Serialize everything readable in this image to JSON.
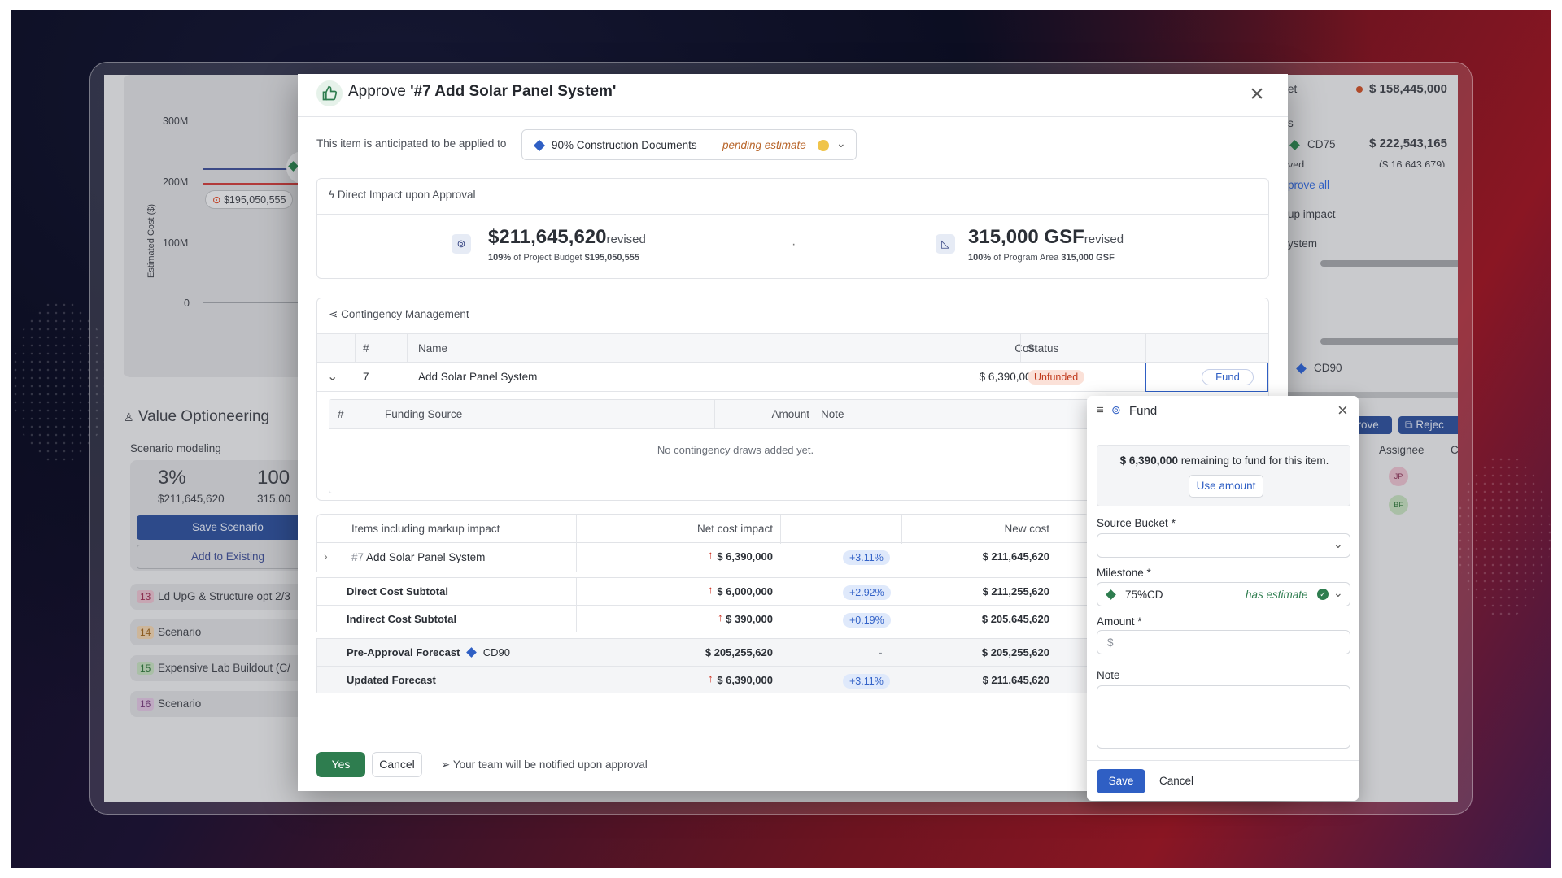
{
  "background_app": {
    "chart": {
      "ylabel": "Estimated Cost ($)",
      "yticks": [
        "300M",
        "200M",
        "100M",
        "0"
      ],
      "budget_marker": "$195,050,555"
    },
    "value_optioneering": {
      "title": "Value Optioneering",
      "subtitle": "Scenario modeling",
      "pct": "3%",
      "amount": "$211,645,620",
      "pct2": "100",
      "area2": "315,00",
      "save_label": "Save Scenario",
      "add_label": "Add to Existing",
      "scenarios": [
        {
          "num": "13",
          "name": "Ld UpG & Structure opt 2/3"
        },
        {
          "num": "14",
          "name": "Scenario"
        },
        {
          "num": "15",
          "name": "Expensive Lab Buildout (C/"
        },
        {
          "num": "16",
          "name": "Scenario"
        }
      ]
    },
    "right_panel": {
      "budget_label": "et",
      "budget_value": "$ 158,445,000",
      "s_label": "s",
      "cd75_label": "CD75",
      "cd75_value": "$ 222,543,165",
      "ved_label": "ved",
      "ved_value": "($ 16,643,679)",
      "approve_all": "prove all",
      "up_impact": "up impact",
      "system": "ystem",
      "cd90": "CD90",
      "approve_btn": "prove",
      "reject_btn": "Rejec",
      "assignee": "Assignee",
      "c_col": "C",
      "avatars": [
        "JP",
        "BF"
      ]
    }
  },
  "modal": {
    "title_prefix": "Approve",
    "title_item": "'#7 Add Solar Panel System'",
    "applied_text": "This item is anticipated to be applied to",
    "milestone": "90% Construction Documents",
    "milestone_status": "pending estimate",
    "direct_impact": {
      "heading": "Direct Impact upon Approval",
      "cost_value": "$211,645,620",
      "cost_suffix": "revised",
      "cost_pct": "109%",
      "cost_of": "of Project Budget",
      "cost_budget": "$195,050,555",
      "dot": "·",
      "area_value": "315,000 GSF",
      "area_suffix": "revised",
      "area_pct": "100%",
      "area_of": "of Program Area",
      "area_total": "315,000 GSF"
    },
    "contingency": {
      "heading": "Contingency Management",
      "columns": [
        "#",
        "Name",
        "Cost",
        "Status"
      ],
      "row": {
        "num": "7",
        "name": "Add Solar Panel System",
        "cost": "$ 6,390,000",
        "status": "Unfunded",
        "action": "Fund"
      },
      "sub_columns": [
        "#",
        "Funding Source",
        "Amount",
        "Note"
      ],
      "empty": "No contingency draws added yet."
    },
    "impact_table": {
      "columns": [
        "Items including markup impact",
        "Net cost impact",
        "New cost"
      ],
      "rows": [
        {
          "prefix": "#7",
          "name": "Add Solar Panel System",
          "net": "$ 6,390,000",
          "pct": "+3.11%",
          "new": "$ 211,645,620"
        },
        {
          "name": "Direct Cost Subtotal",
          "net": "$ 6,000,000",
          "pct": "+2.92%",
          "new": "$ 211,255,620"
        },
        {
          "name": "Indirect Cost Subtotal",
          "net": "$ 390,000",
          "pct": "+0.19%",
          "new": "$ 205,645,620"
        },
        {
          "name": "Pre-Approval Forecast",
          "tag": "CD90",
          "net": "$ 205,255,620",
          "pct": "-",
          "new": "$ 205,255,620"
        },
        {
          "name": "Updated Forecast",
          "net": "$ 6,390,000",
          "pct": "+3.11%",
          "new": "$ 211,645,620"
        }
      ]
    },
    "footer": {
      "yes": "Yes",
      "cancel": "Cancel",
      "notify": "Your team will be notified upon approval"
    }
  },
  "fund": {
    "title": "Fund",
    "remaining_value": "$ 6,390,000",
    "remaining_text": "remaining to fund for this item.",
    "use_amount": "Use amount",
    "source_label": "Source Bucket",
    "milestone_label": "Milestone",
    "milestone_value": "75%CD",
    "milestone_status": "has estimate",
    "amount_label": "Amount",
    "amount_placeholder": "$",
    "note_label": "Note",
    "required_mark": "*",
    "save": "Save",
    "cancel": "Cancel"
  },
  "colors": {
    "accent_blue": "#2f5fc4",
    "approve_green": "#2e7d4f",
    "unfunded_red": "#c0391b"
  }
}
